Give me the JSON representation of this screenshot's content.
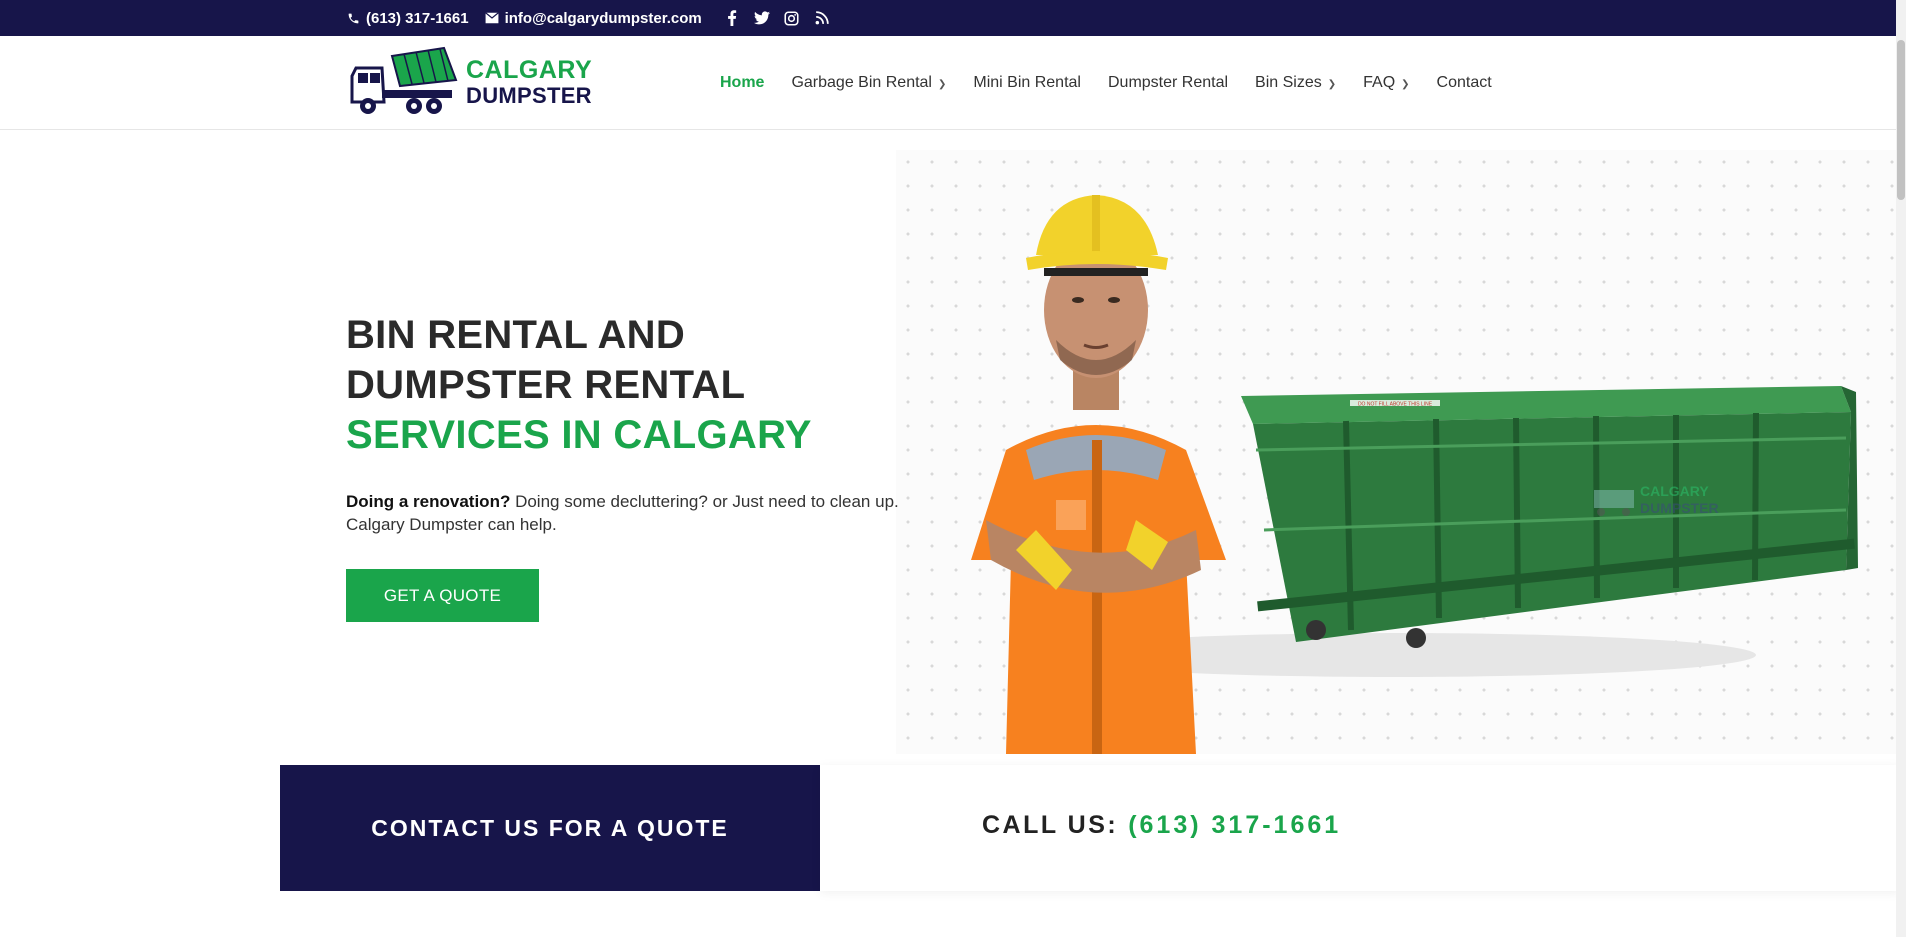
{
  "topbar": {
    "phone": "(613) 317-1661",
    "email": "info@calgarydumpster.com",
    "social": [
      "facebook-icon",
      "twitter-icon",
      "instagram-icon",
      "rss-icon"
    ]
  },
  "logo": {
    "line1": "CALGARY",
    "line2": "DUMPSTER"
  },
  "nav": {
    "items": [
      {
        "label": "Home",
        "active": true
      },
      {
        "label": "Garbage Bin Rental",
        "dropdown": true
      },
      {
        "label": "Mini Bin Rental"
      },
      {
        "label": "Dumpster Rental"
      },
      {
        "label": "Bin Sizes",
        "dropdown": true
      },
      {
        "label": "FAQ",
        "dropdown": true
      },
      {
        "label": "Contact"
      }
    ]
  },
  "hero": {
    "title_line1": "BIN RENTAL AND",
    "title_line2": "DUMPSTER RENTAL",
    "title_line3": "SERVICES IN CALGARY",
    "sub_bold": "Doing a renovation?",
    "sub_rest": " Doing some decluttering? or Just need to clean up.",
    "sub_line2": "Calgary Dumpster can help.",
    "cta": "GET A QUOTE",
    "dumpster_logo_line1": "CALGARY",
    "dumpster_logo_line2": "DUMPSTER",
    "dumpster_label": "DO NOT FILL ABOVE THIS LINE"
  },
  "bottom": {
    "contact": "CONTACT US FOR A QUOTE",
    "call_label": "CALL US:",
    "call_phone": "(613) 317-1661"
  },
  "colors": {
    "brand_navy": "#17154a",
    "brand_green": "#1aa54b",
    "dumpster_green": "#2d7a3e",
    "vest_orange": "#f7811f",
    "helmet_yellow": "#f2d22b"
  }
}
